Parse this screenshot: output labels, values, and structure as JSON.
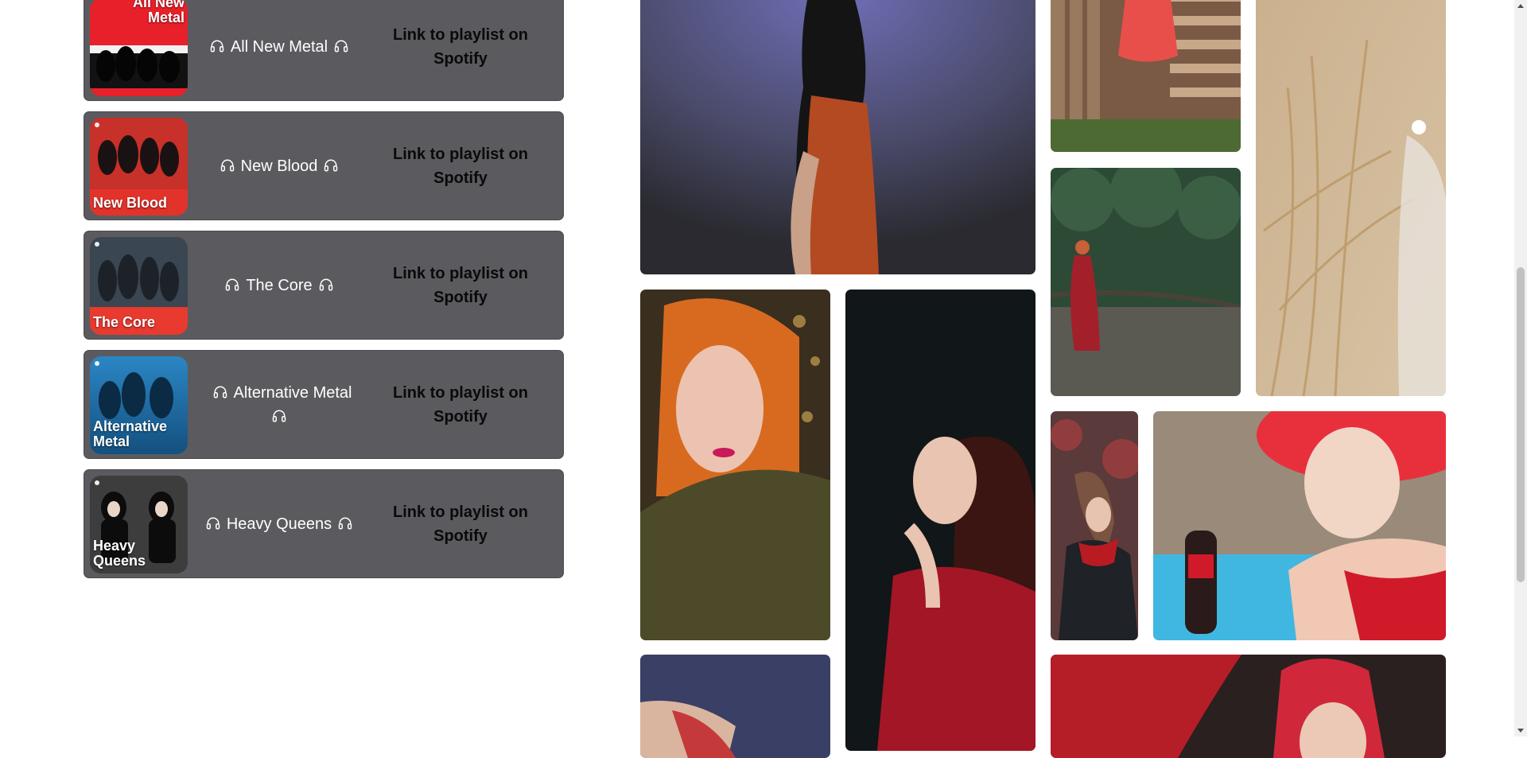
{
  "playlists": [
    {
      "name": "All New Metal",
      "cover_text": "All New Metal",
      "link_text": "Link to playlist on Spotify",
      "cover_color": "#e8202a"
    },
    {
      "name": "New Blood",
      "cover_text": "New Blood",
      "link_text": "Link to playlist on Spotify",
      "cover_color": "#e2332b"
    },
    {
      "name": "The Core",
      "cover_text": "The Core",
      "link_text": "Link to playlist on Spotify",
      "cover_color": "#e83a2e"
    },
    {
      "name": "Alternative Metal",
      "cover_text": "Alternative Metal",
      "link_text": "Link to playlist on Spotify",
      "cover_color": "#1f6ea8"
    },
    {
      "name": "Heavy Queens",
      "cover_text": "Heavy Queens",
      "link_text": "Link to playlist on Spotify",
      "cover_color": "#2a2a2a"
    }
  ],
  "icons": {
    "playlist_icon": "headphones-icon"
  },
  "gallery": {
    "photos": [
      "woman-dancing-orange-skirt-photo",
      "woman-red-dress-wooden-fence-photo",
      "woman-in-wheat-field-photo",
      "woman-red-dress-in-river-photo",
      "redhead-woman-portrait-photo",
      "woman-red-top-dark-background-photo",
      "woman-with-red-scarf-photo",
      "woman-red-hat-drinking-soda-photo",
      "shoes-photo",
      "woman-red-headscarf-photo"
    ]
  },
  "colors": {
    "card_bg": "#5b5b5f",
    "card_text": "#ffffff",
    "link_text": "#0a0a0a"
  }
}
